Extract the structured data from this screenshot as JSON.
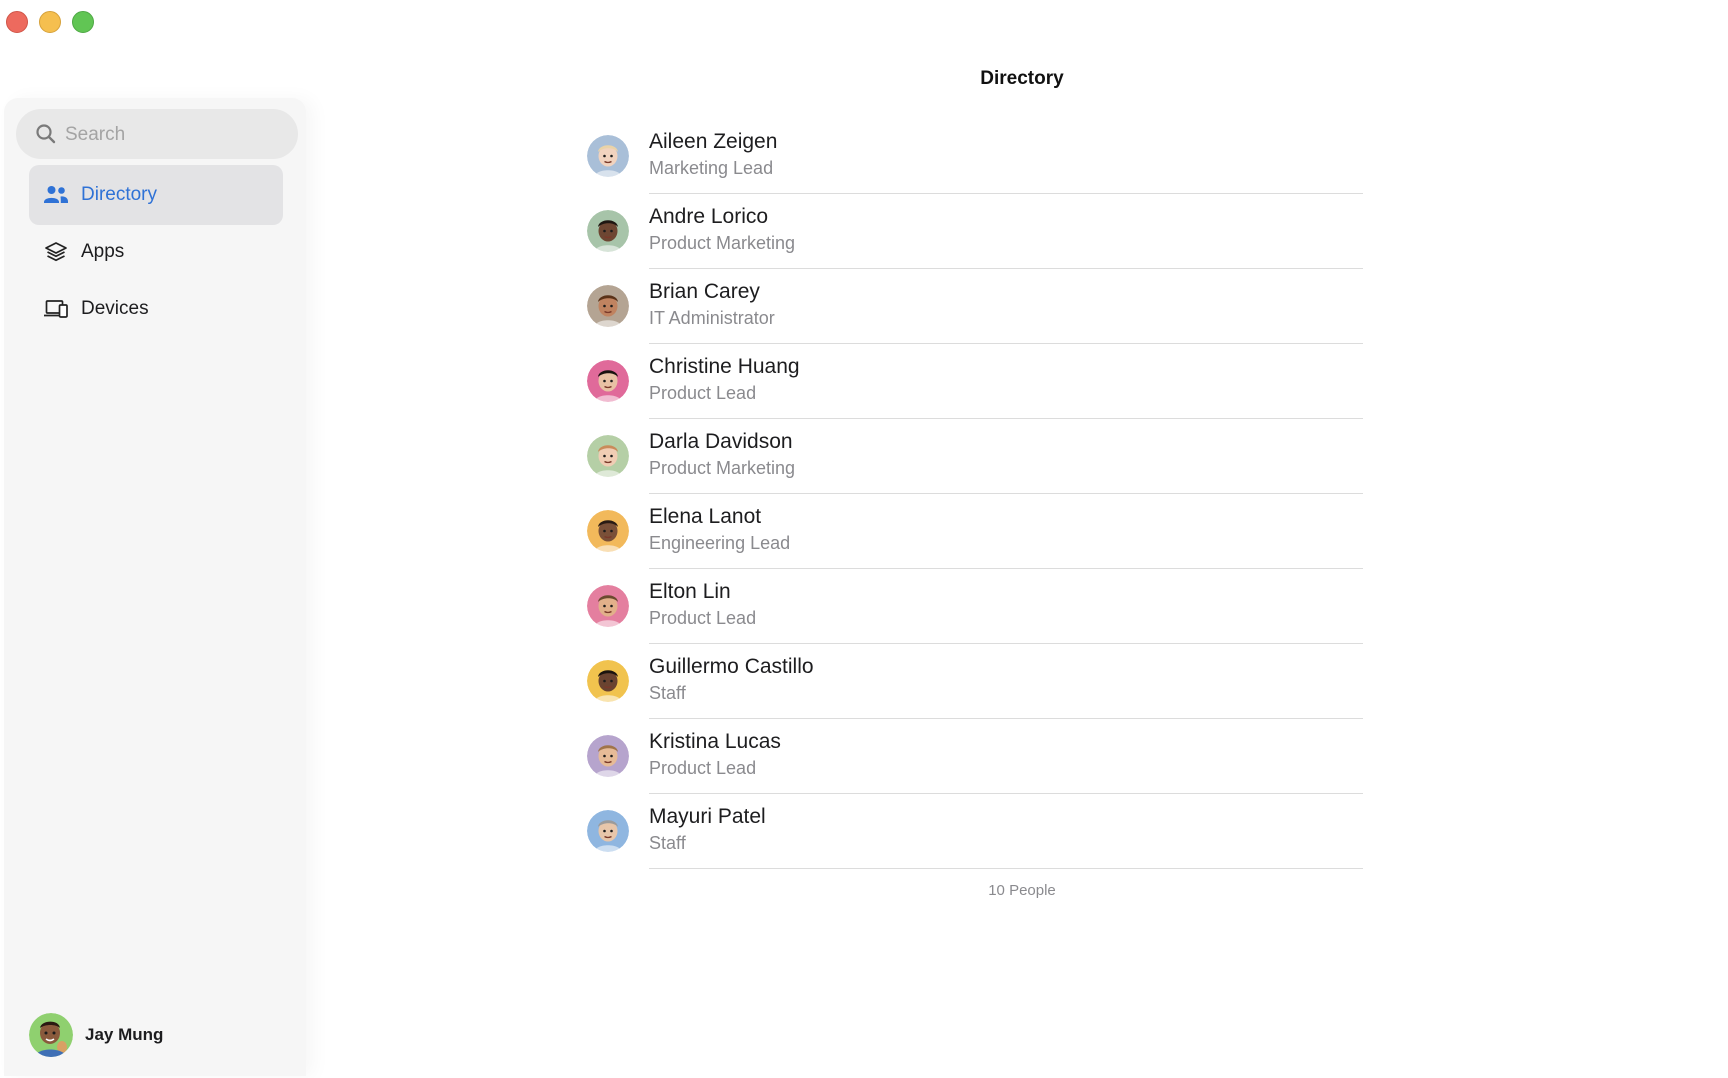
{
  "window": {
    "title": "Directory"
  },
  "sidebar": {
    "search": {
      "placeholder": "Search"
    },
    "items": [
      {
        "label": "Directory",
        "icon": "people-icon",
        "selected": true
      },
      {
        "label": "Apps",
        "icon": "stack-icon",
        "selected": false
      },
      {
        "label": "Devices",
        "icon": "devices-icon",
        "selected": false
      }
    ],
    "user": {
      "name": "Jay Mung",
      "avatar_bg": "#8fd06f"
    }
  },
  "main": {
    "title": "Directory",
    "people": [
      {
        "name": "Aileen Zeigen",
        "role": "Marketing Lead",
        "avatar_bg": "#a9bfd8"
      },
      {
        "name": "Andre Lorico",
        "role": "Product Marketing",
        "avatar_bg": "#a7c4a9"
      },
      {
        "name": "Brian Carey",
        "role": "IT Administrator",
        "avatar_bg": "#b4a493"
      },
      {
        "name": "Christine Huang",
        "role": "Product Lead",
        "avatar_bg": "#e06a9a"
      },
      {
        "name": "Darla Davidson",
        "role": "Product Marketing",
        "avatar_bg": "#b5cfa6"
      },
      {
        "name": "Elena Lanot",
        "role": "Engineering Lead",
        "avatar_bg": "#f2b95b"
      },
      {
        "name": "Elton Lin",
        "role": "Product Lead",
        "avatar_bg": "#e47f9f"
      },
      {
        "name": "Guillermo Castillo",
        "role": "Staff",
        "avatar_bg": "#f1c34e"
      },
      {
        "name": "Kristina Lucas",
        "role": "Product Lead",
        "avatar_bg": "#b6a4cd"
      },
      {
        "name": "Mayuri Patel",
        "role": "Staff",
        "avatar_bg": "#8fb6e0"
      }
    ],
    "count_label": "10 People"
  },
  "colors": {
    "accent": "#2f72d6",
    "selected_bg": "#e3e3e5",
    "sidebar_bg": "#f6f6f6"
  }
}
